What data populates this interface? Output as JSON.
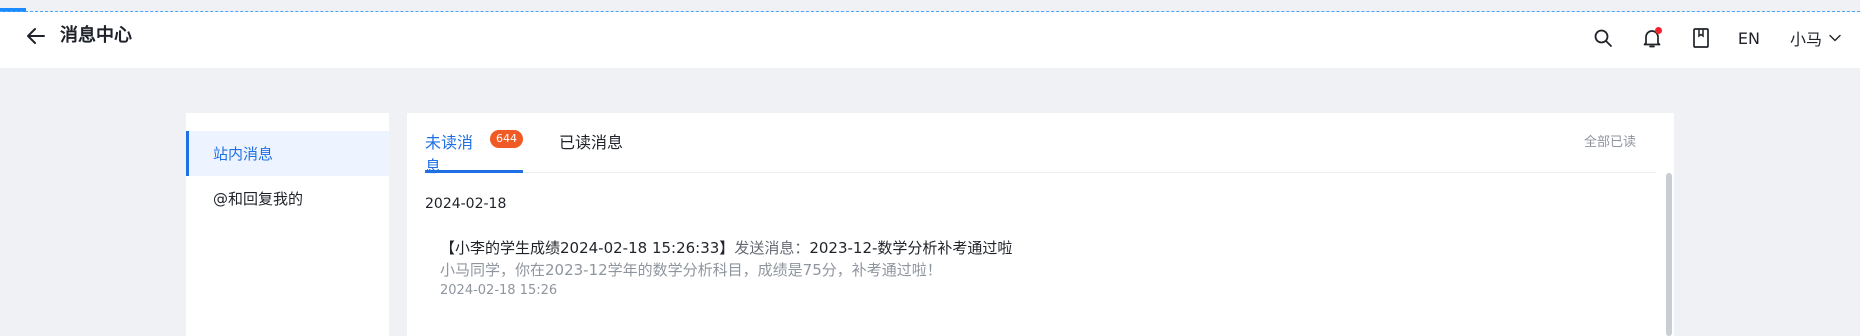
{
  "header": {
    "title": "消息中心",
    "language": "EN",
    "user_name": "小马",
    "icons": [
      "arrow-left-icon",
      "search-icon",
      "bell-icon",
      "book-icon",
      "chevron-down-icon"
    ],
    "notification_dot_color": "#f5222d"
  },
  "sidebar": {
    "items": [
      {
        "label": "站内消息",
        "active": true
      },
      {
        "label": "@和回复我的",
        "active": false
      }
    ]
  },
  "tabs": {
    "unread_label": "未读消息",
    "unread_count": "644",
    "read_label": "已读消息",
    "mark_all_read": "全部已读"
  },
  "messages": {
    "date": "2024-02-18",
    "items": [
      {
        "title_prefix": "【小李的学生成绩2024-02-18 15:26:33】",
        "title_action": "发送消息：",
        "title_subject": "2023-12-数学分析补考通过啦",
        "body": "小马同学，你在2023-12学年的数学分析科目，成绩是75分，补考通过啦！",
        "time": "2024-02-18 15:26"
      }
    ]
  },
  "colors": {
    "accent": "#1f6fe5",
    "badge": "#f05a24",
    "background": "#f0f1f4"
  }
}
